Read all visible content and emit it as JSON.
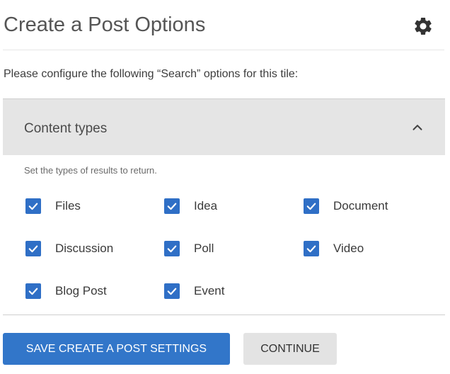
{
  "header": {
    "title": "Create a Post Options",
    "settings_icon": "gear-icon"
  },
  "intro_text": "Please configure the following “Search” options for this tile:",
  "panel": {
    "title": "Content types",
    "expanded": true,
    "toggle_icon": "chevron-up-icon",
    "hint": "Set the types of results to return."
  },
  "content_types": [
    {
      "label": "Files",
      "checked": true
    },
    {
      "label": "Idea",
      "checked": true
    },
    {
      "label": "Document",
      "checked": true
    },
    {
      "label": "Discussion",
      "checked": true
    },
    {
      "label": "Poll",
      "checked": true
    },
    {
      "label": "Video",
      "checked": true
    },
    {
      "label": "Blog Post",
      "checked": true
    },
    {
      "label": "Event",
      "checked": true
    }
  ],
  "actions": {
    "save_label": "SAVE CREATE A POST SETTINGS",
    "continue_label": "CONTINUE"
  },
  "colors": {
    "accent": "#3276c9",
    "checkbox": "#2f6fc6",
    "panel_bg": "#e5e5e5",
    "secondary_button": "#e3e3e3"
  }
}
